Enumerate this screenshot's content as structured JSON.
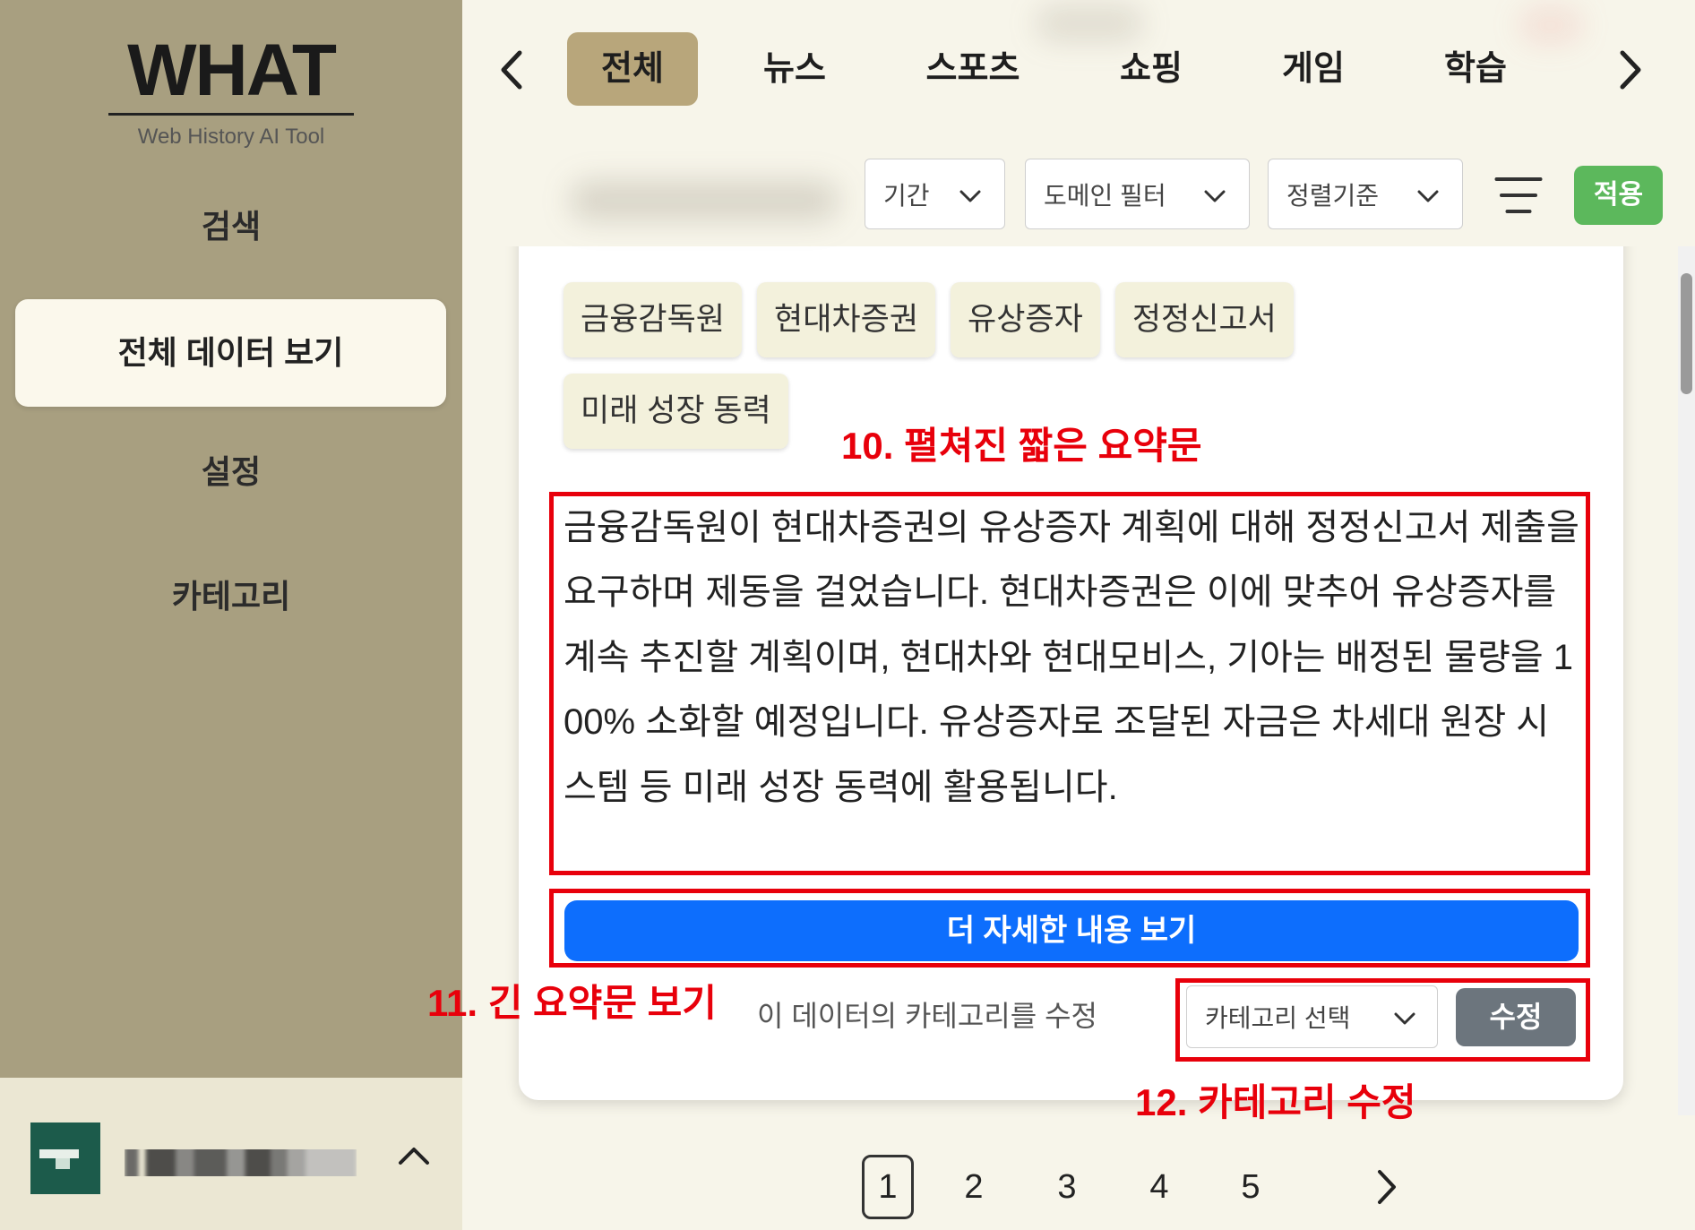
{
  "app": {
    "logo": "WHAT",
    "tagline": "Web History AI Tool"
  },
  "sidebar": {
    "items": [
      {
        "label": "검색",
        "active": false
      },
      {
        "label": "전체 데이터 보기",
        "active": true
      },
      {
        "label": "설정",
        "active": false
      },
      {
        "label": "카테고리",
        "active": false
      }
    ],
    "user": {
      "avatar_icon": "user-avatar-icon",
      "expand_icon": "chevron-up-icon"
    }
  },
  "tabs": {
    "prev_icon": "chevron-left-icon",
    "next_icon": "chevron-right-icon",
    "items": [
      {
        "label": "전체",
        "active": true
      },
      {
        "label": "뉴스",
        "active": false
      },
      {
        "label": "스포츠",
        "active": false
      },
      {
        "label": "쇼핑",
        "active": false
      },
      {
        "label": "게임",
        "active": false
      },
      {
        "label": "학습",
        "active": false
      }
    ]
  },
  "filters": {
    "period": "기간",
    "domain": "도메인 필터",
    "sort": "정렬기준",
    "dropdown_icon": "chevron-down-icon",
    "filter_icon": "filter-lines-icon",
    "apply": "적용"
  },
  "card": {
    "tags": [
      "금융감독원",
      "현대차증권",
      "유상증자",
      "정정신고서",
      "미래 성장 동력"
    ],
    "summary": "금융감독원이 현대차증권의 유상증자 계획에 대해 정정신고서 제출을 요구하며 제동을 걸었습니다. 현대차증권은 이에 맞추어 유상증자를 계속 추진할 계획이며, 현대차와 현대모비스, 기아는 배정된 물량을 100% 소화할 예정입니다. 유상증자로 조달된 자금은 차세대 원장 시스템 등 미래 성장 동력에 활용됩니다.",
    "more_button": "더 자세한 내용 보기",
    "category_prompt": "이 데이터의 카테고리를 수정",
    "category_select": "카테고리 선택",
    "edit_button": "수정"
  },
  "annotations": [
    {
      "label": "10. 펼쳐진 짧은 요약문"
    },
    {
      "label": "11. 긴 요약문 보기"
    },
    {
      "label": "12. 카테고리 수정"
    }
  ],
  "pagination": {
    "pages": [
      "1",
      "2",
      "3",
      "4",
      "5"
    ],
    "current": "1",
    "next_icon": "chevron-right-icon"
  },
  "colors": {
    "sidebar_bg": "#a89f80",
    "sidebar_active_bg": "#fbf8ec",
    "user_panel_bg": "#ebe7d3",
    "main_bg": "#f7f5ea",
    "tab_active_bg": "#b8a67b",
    "tag_bg": "#f3f1dc",
    "apply_green": "#5cb85c",
    "primary_blue": "#0d6efd",
    "secondary_grey": "#6c757d",
    "annotation_red": "#e8000b",
    "avatar_green": "#1c5b4b"
  }
}
